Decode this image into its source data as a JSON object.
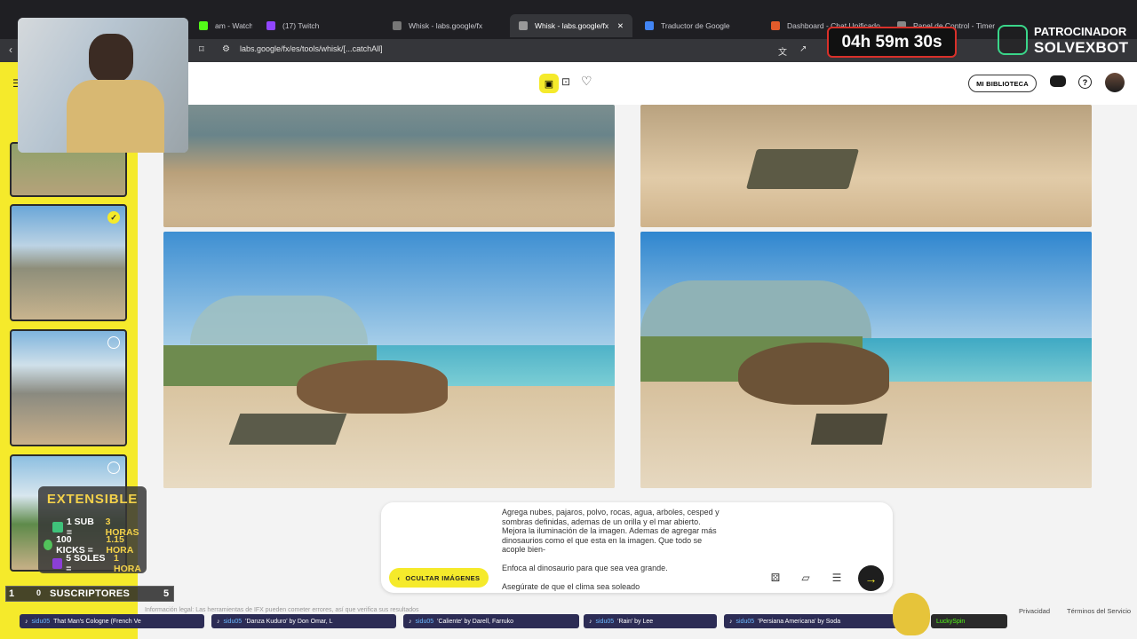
{
  "browser": {
    "tabs": [
      {
        "label": "am - Watch Live on",
        "color": "#53fc18"
      },
      {
        "label": "(17) Twitch",
        "color": "#9146ff"
      },
      {
        "label": "Whisk - labs.google/fx",
        "color": "#555"
      },
      {
        "label": "Whisk - labs.google/fx",
        "color": "#555"
      },
      {
        "label": "Traductor de Google",
        "color": "#4285f4"
      },
      {
        "label": "Dashboard - Chat Unificado",
        "color": "#e25b2b"
      },
      {
        "label": "Panel de Control - Timer",
        "color": "#888"
      }
    ],
    "url": "labs.google/fx/es/tools/whisk/[...catchAll]"
  },
  "app": {
    "library_label": "MI BIBLIOTECA",
    "hide_images_label": "OCULTAR IMÁGENES",
    "prompt_lines": [
      "Agrega nubes, pajaros, polvo, rocas, agua, arboles, cesped y",
      "sombras definidas, ademas de un orilla y el mar abierto.",
      "Mejora la iluminación de la imagen. Ademas de agregar más",
      "dinosaurios como el que esta en la imagen. Que todo se",
      "acople bien-",
      "",
      "Enfoca al dinosaurio para que sea vea grande.",
      "",
      "Asegúrate de que el clima sea soleado"
    ],
    "legal_text": "Información legal: Las herramientas de IFX pueden cometer errores, así que verifica sus resultados",
    "privacy_label": "Privacidad",
    "terms_label": "Términos del Servicio"
  },
  "overlay": {
    "timer": "04h 59m 30s",
    "sponsor_line1": "PATROCINADOR",
    "sponsor_line2": "SOLVEXBOT",
    "extensible_title": "EXTENSIBLE",
    "ext_rows": [
      {
        "pre": "1 SUB = ",
        "acc": "3 HORAS"
      },
      {
        "pre": "100 KICKS = ",
        "acc": "1.15 HORA"
      },
      {
        "pre": "5 SOLES = ",
        "acc": "1 HORA"
      }
    ],
    "subs_left": "1",
    "subs_mid": "0",
    "subs_label": "SUSCRIPTORES",
    "subs_right": "5",
    "ticker": [
      {
        "user": "sidu05",
        "text": "That Man's Cologne (French Ve"
      },
      {
        "user": "sidu05",
        "text": "'Danza Kuduro' by Don Omar, L"
      },
      {
        "user": "sidu05",
        "text": "'Caliente' by Darell, Farruko"
      },
      {
        "user": "sidu05",
        "text": "'Rain' by Lee"
      },
      {
        "user": "sidu05",
        "text": "'Persiana Americana' by Soda"
      },
      {
        "user": "LuckySpin",
        "text": ""
      }
    ]
  }
}
